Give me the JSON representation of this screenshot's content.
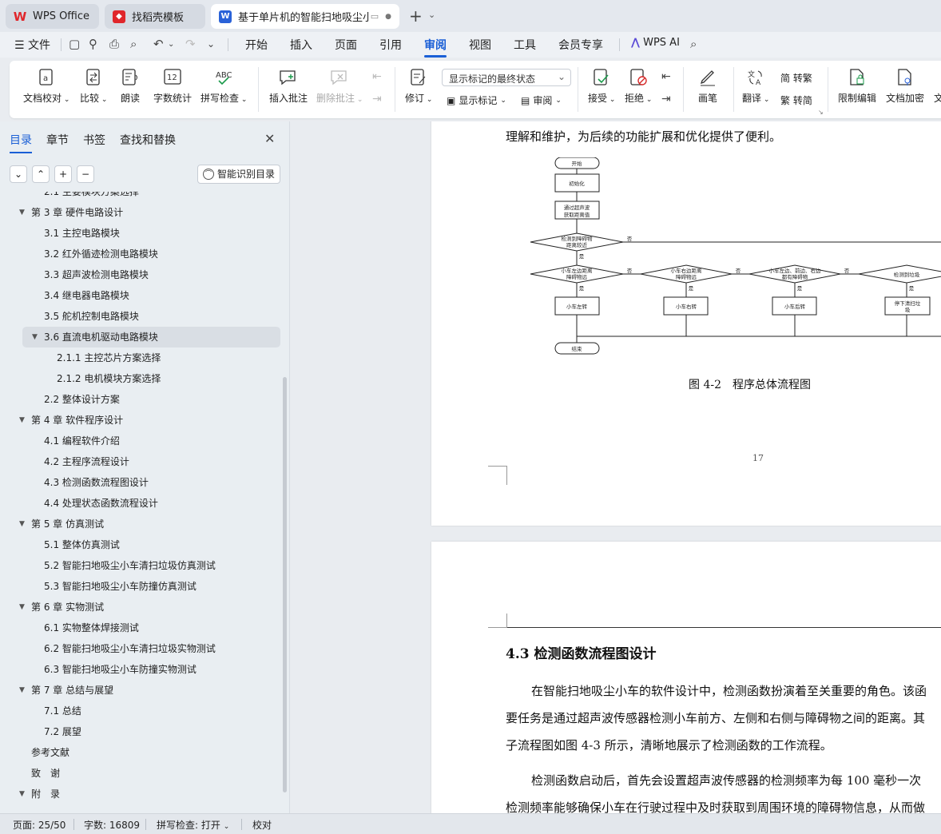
{
  "tabs": [
    {
      "label": "WPS Office",
      "icon": "wps-logo-icon"
    },
    {
      "label": "找稻壳模板",
      "icon": "docer-icon"
    },
    {
      "label": "基于单片机的智能扫地吸尘小车",
      "icon": "word-doc-icon"
    }
  ],
  "menu": {
    "file": "文件",
    "items": [
      "开始",
      "插入",
      "页面",
      "引用",
      "审阅",
      "视图",
      "工具",
      "会员专享"
    ],
    "active": "审阅",
    "wps_ai": "WPS AI"
  },
  "ribbon": {
    "proof": "文档校对",
    "compare": "比较",
    "read_aloud": "朗读",
    "word_count": "字数统计",
    "word_count_icon_text": "12",
    "spell_check": "拼写检查",
    "spell_icon_text": "ABC",
    "insert_comment": "插入批注",
    "delete_comment": "删除批注",
    "track": "修订",
    "markup_state": "显示标记的最终状态",
    "show_markup": "显示标记",
    "review_pane": "审阅",
    "accept": "接受",
    "reject": "拒绝",
    "ink": "画笔",
    "translate": "翻译",
    "to_trad": "简 转繁",
    "to_simp": "繁 转简",
    "restrict": "限制编辑",
    "encrypt": "文档加密",
    "more": "文"
  },
  "sidebar": {
    "tabs": [
      "目录",
      "章节",
      "书签",
      "查找和替换"
    ],
    "smart_toc": "智能识别目录",
    "toc": [
      {
        "text": "2.1 主要模块方案选择",
        "level": 2
      },
      {
        "text": "第 3 章 硬件电路设计",
        "level": 1,
        "caret": true
      },
      {
        "text": "3.1 主控电路模块",
        "level": 2
      },
      {
        "text": "3.2 红外循迹检测电路模块",
        "level": 2
      },
      {
        "text": "3.3 超声波检测电路模块",
        "level": 2
      },
      {
        "text": "3.4 继电器电路模块",
        "level": 2
      },
      {
        "text": "3.5 舵机控制电路模块",
        "level": 2
      },
      {
        "text": "3.6 直流电机驱动电路模块",
        "level": 2,
        "caret": true,
        "selected": true
      },
      {
        "text": "2.1.1 主控芯片方案选择",
        "level": 3
      },
      {
        "text": "2.1.2 电机模块方案选择",
        "level": 3
      },
      {
        "text": "2.2 整体设计方案",
        "level": 2
      },
      {
        "text": "第 4 章 软件程序设计",
        "level": 1,
        "caret": true
      },
      {
        "text": "4.1 编程软件介绍",
        "level": 2
      },
      {
        "text": "4.2 主程序流程设计",
        "level": 2
      },
      {
        "text": "4.3 检测函数流程图设计",
        "level": 2
      },
      {
        "text": "4.4 处理状态函数流程设计",
        "level": 2
      },
      {
        "text": "第 5 章 仿真测试",
        "level": 1,
        "caret": true
      },
      {
        "text": "5.1 整体仿真测试",
        "level": 2
      },
      {
        "text": "5.2 智能扫地吸尘小车清扫垃圾仿真测试",
        "level": 2
      },
      {
        "text": "5.3 智能扫地吸尘小车防撞仿真测试",
        "level": 2
      },
      {
        "text": "第 6 章 实物测试",
        "level": 1,
        "caret": true
      },
      {
        "text": "6.1 实物整体焊接测试",
        "level": 2
      },
      {
        "text": "6.2 智能扫地吸尘小车清扫垃圾实物测试",
        "level": 2
      },
      {
        "text": "6.3 智能扫地吸尘小车防撞实物测试",
        "level": 2
      },
      {
        "text": "第 7 章 总结与展望",
        "level": 1,
        "caret": true
      },
      {
        "text": "7.1 总结",
        "level": 2
      },
      {
        "text": "7.2 展望",
        "level": 2
      },
      {
        "text": "参考文献",
        "level": 1
      },
      {
        "text": "致　谢",
        "level": 1
      },
      {
        "text": "附　录",
        "level": 1,
        "caret": true
      }
    ]
  },
  "document": {
    "page1_top_line": "理解和维护，为后续的功能扩展和优化提供了便利。",
    "flow": {
      "start": "开始",
      "init": "初始化",
      "measure_1": "通过超声波",
      "measure_2": "获取距离值",
      "compare_1": "检测到障碍物",
      "compare_2": "距离较近",
      "left_1": "小车左边距离",
      "left_2": "障碍物远",
      "right_1": "小车右边距离",
      "right_2": "障碍物远",
      "both_1": "小车左边、前边、右边",
      "both_2": "都有障碍物",
      "trash": "检测到垃圾",
      "turn_left": "小车左转",
      "turn_right": "小车右转",
      "back": "小车后转",
      "stop_1": "停下清扫垃",
      "stop_2": "圾",
      "end": "结束",
      "yes": "是",
      "no": "否"
    },
    "figure_caption": "图 4-2　程序总体流程图",
    "page_number": "17",
    "section_heading": "4.3  检测函数流程图设计",
    "para1_line1": "在智能扫地吸尘小车的软件设计中，检测函数扮演着至关重要的角色。该函",
    "para1_line2": "要任务是通过超声波传感器检测小车前方、左侧和右侧与障碍物之间的距离。其",
    "para1_line3": "子流程图如图 4-3 所示，清晰地展示了检测函数的工作流程。",
    "para2_line1": "检测函数启动后，首先会设置超声波传感器的检测频率为每 100 毫秒一次",
    "para2_line2": "检测频率能够确保小车在行驶过程中及时获取到周围环境的障碍物信息，从而做"
  },
  "status": {
    "page": "页面: 25/50",
    "words": "字数: 16809",
    "spell": "拼写检查: 打开",
    "proof": "校对"
  }
}
